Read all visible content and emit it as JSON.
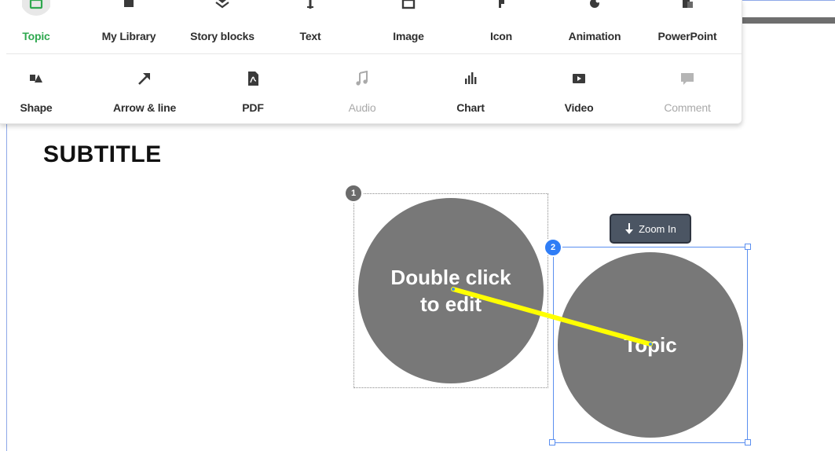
{
  "toolbar": {
    "row1": [
      {
        "label": "Topic",
        "icon": "topic-icon",
        "active": true
      },
      {
        "label": "My Library",
        "icon": "library-icon"
      },
      {
        "label": "Story blocks",
        "icon": "story-blocks-icon"
      },
      {
        "label": "Text",
        "icon": "text-icon"
      },
      {
        "label": "Image",
        "icon": "image-icon"
      },
      {
        "label": "Icon",
        "icon": "icon-icon"
      },
      {
        "label": "Animation",
        "icon": "animation-icon"
      },
      {
        "label": "PowerPoint",
        "icon": "powerpoint-icon"
      }
    ],
    "row2": [
      {
        "label": "Shape",
        "icon": "shape-icon"
      },
      {
        "label": "Arrow & line",
        "icon": "arrow-icon"
      },
      {
        "label": "PDF",
        "icon": "pdf-icon"
      },
      {
        "label": "Audio",
        "icon": "audio-icon",
        "disabled": true
      },
      {
        "label": "Chart",
        "icon": "chart-icon"
      },
      {
        "label": "Video",
        "icon": "video-icon"
      },
      {
        "label": "Comment",
        "icon": "comment-icon",
        "disabled": true
      }
    ],
    "colors": {
      "active": "#2fa84f",
      "text": "#2e2e2e",
      "disabled": "#a9a9a9"
    }
  },
  "slide": {
    "subtitle": "SUBTITLE",
    "topic1": {
      "badge": "1",
      "text_line1": "Double click",
      "text_line2": "to edit"
    },
    "topic2": {
      "badge": "2",
      "text": "Topic"
    },
    "zoom_button": "Zoom In",
    "colors": {
      "circle": "#787878",
      "selection": "#5b8ff0",
      "connector": "#ffff00",
      "badge_selected": "#2f7df6",
      "badge_default": "#6b6b6b"
    }
  }
}
